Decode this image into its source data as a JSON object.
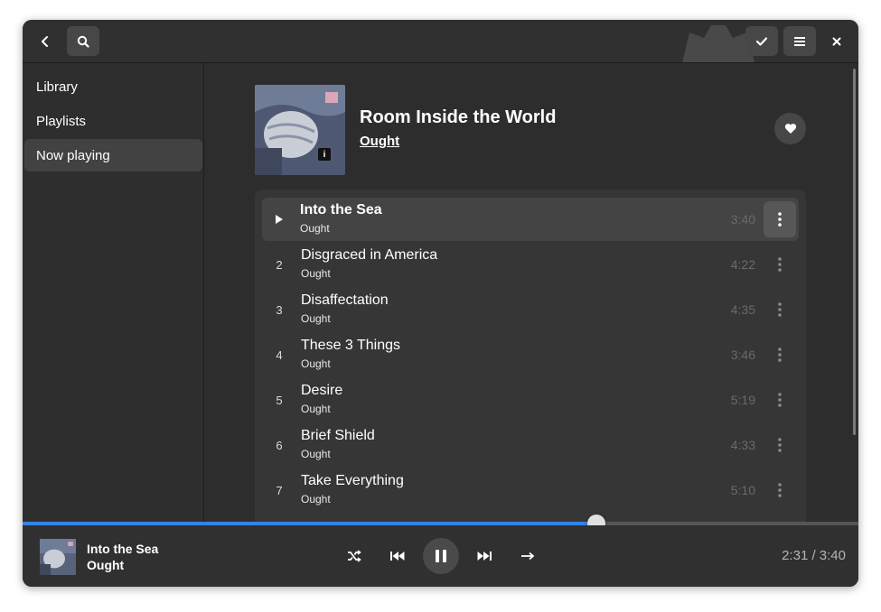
{
  "icons": {
    "back": "back-icon",
    "search": "search-icon",
    "select": "checkmark-icon",
    "menu": "hamburger-menu-icon",
    "close": "close-icon",
    "info": "info-icon",
    "favorite": "heart-icon",
    "play": "play-icon",
    "track_menu": "vertical-dots-icon",
    "shuffle": "shuffle-icon",
    "previous": "skip-previous-icon",
    "pause": "pause-icon",
    "next": "skip-next-icon",
    "repeat": "repeat-icon"
  },
  "colors": {
    "accent": "#3584e4",
    "window_bg": "#2d2d2d",
    "list_bg": "#363636"
  },
  "sidebar": {
    "items": [
      {
        "label": "Library",
        "active": false
      },
      {
        "label": "Playlists",
        "active": false
      },
      {
        "label": "Now playing",
        "active": true
      }
    ]
  },
  "album": {
    "title": "Room Inside the World",
    "artist": "Ought",
    "info_badge": "i"
  },
  "tracks": [
    {
      "number": "",
      "title": "Into the Sea",
      "artist": "Ought",
      "duration": "3:40",
      "playing": true
    },
    {
      "number": "2",
      "title": "Disgraced in America",
      "artist": "Ought",
      "duration": "4:22"
    },
    {
      "number": "3",
      "title": "Disaffectation",
      "artist": "Ought",
      "duration": "4:35"
    },
    {
      "number": "4",
      "title": "These 3 Things",
      "artist": "Ought",
      "duration": "3:46"
    },
    {
      "number": "5",
      "title": "Desire",
      "artist": "Ought",
      "duration": "5:19"
    },
    {
      "number": "6",
      "title": "Brief Shield",
      "artist": "Ought",
      "duration": "4:33"
    },
    {
      "number": "7",
      "title": "Take Everything",
      "artist": "Ought",
      "duration": "5:10"
    }
  ],
  "player": {
    "title": "Into the Sea",
    "artist": "Ought",
    "time": "2:31 / 3:40",
    "progress_fraction": 0.686
  }
}
